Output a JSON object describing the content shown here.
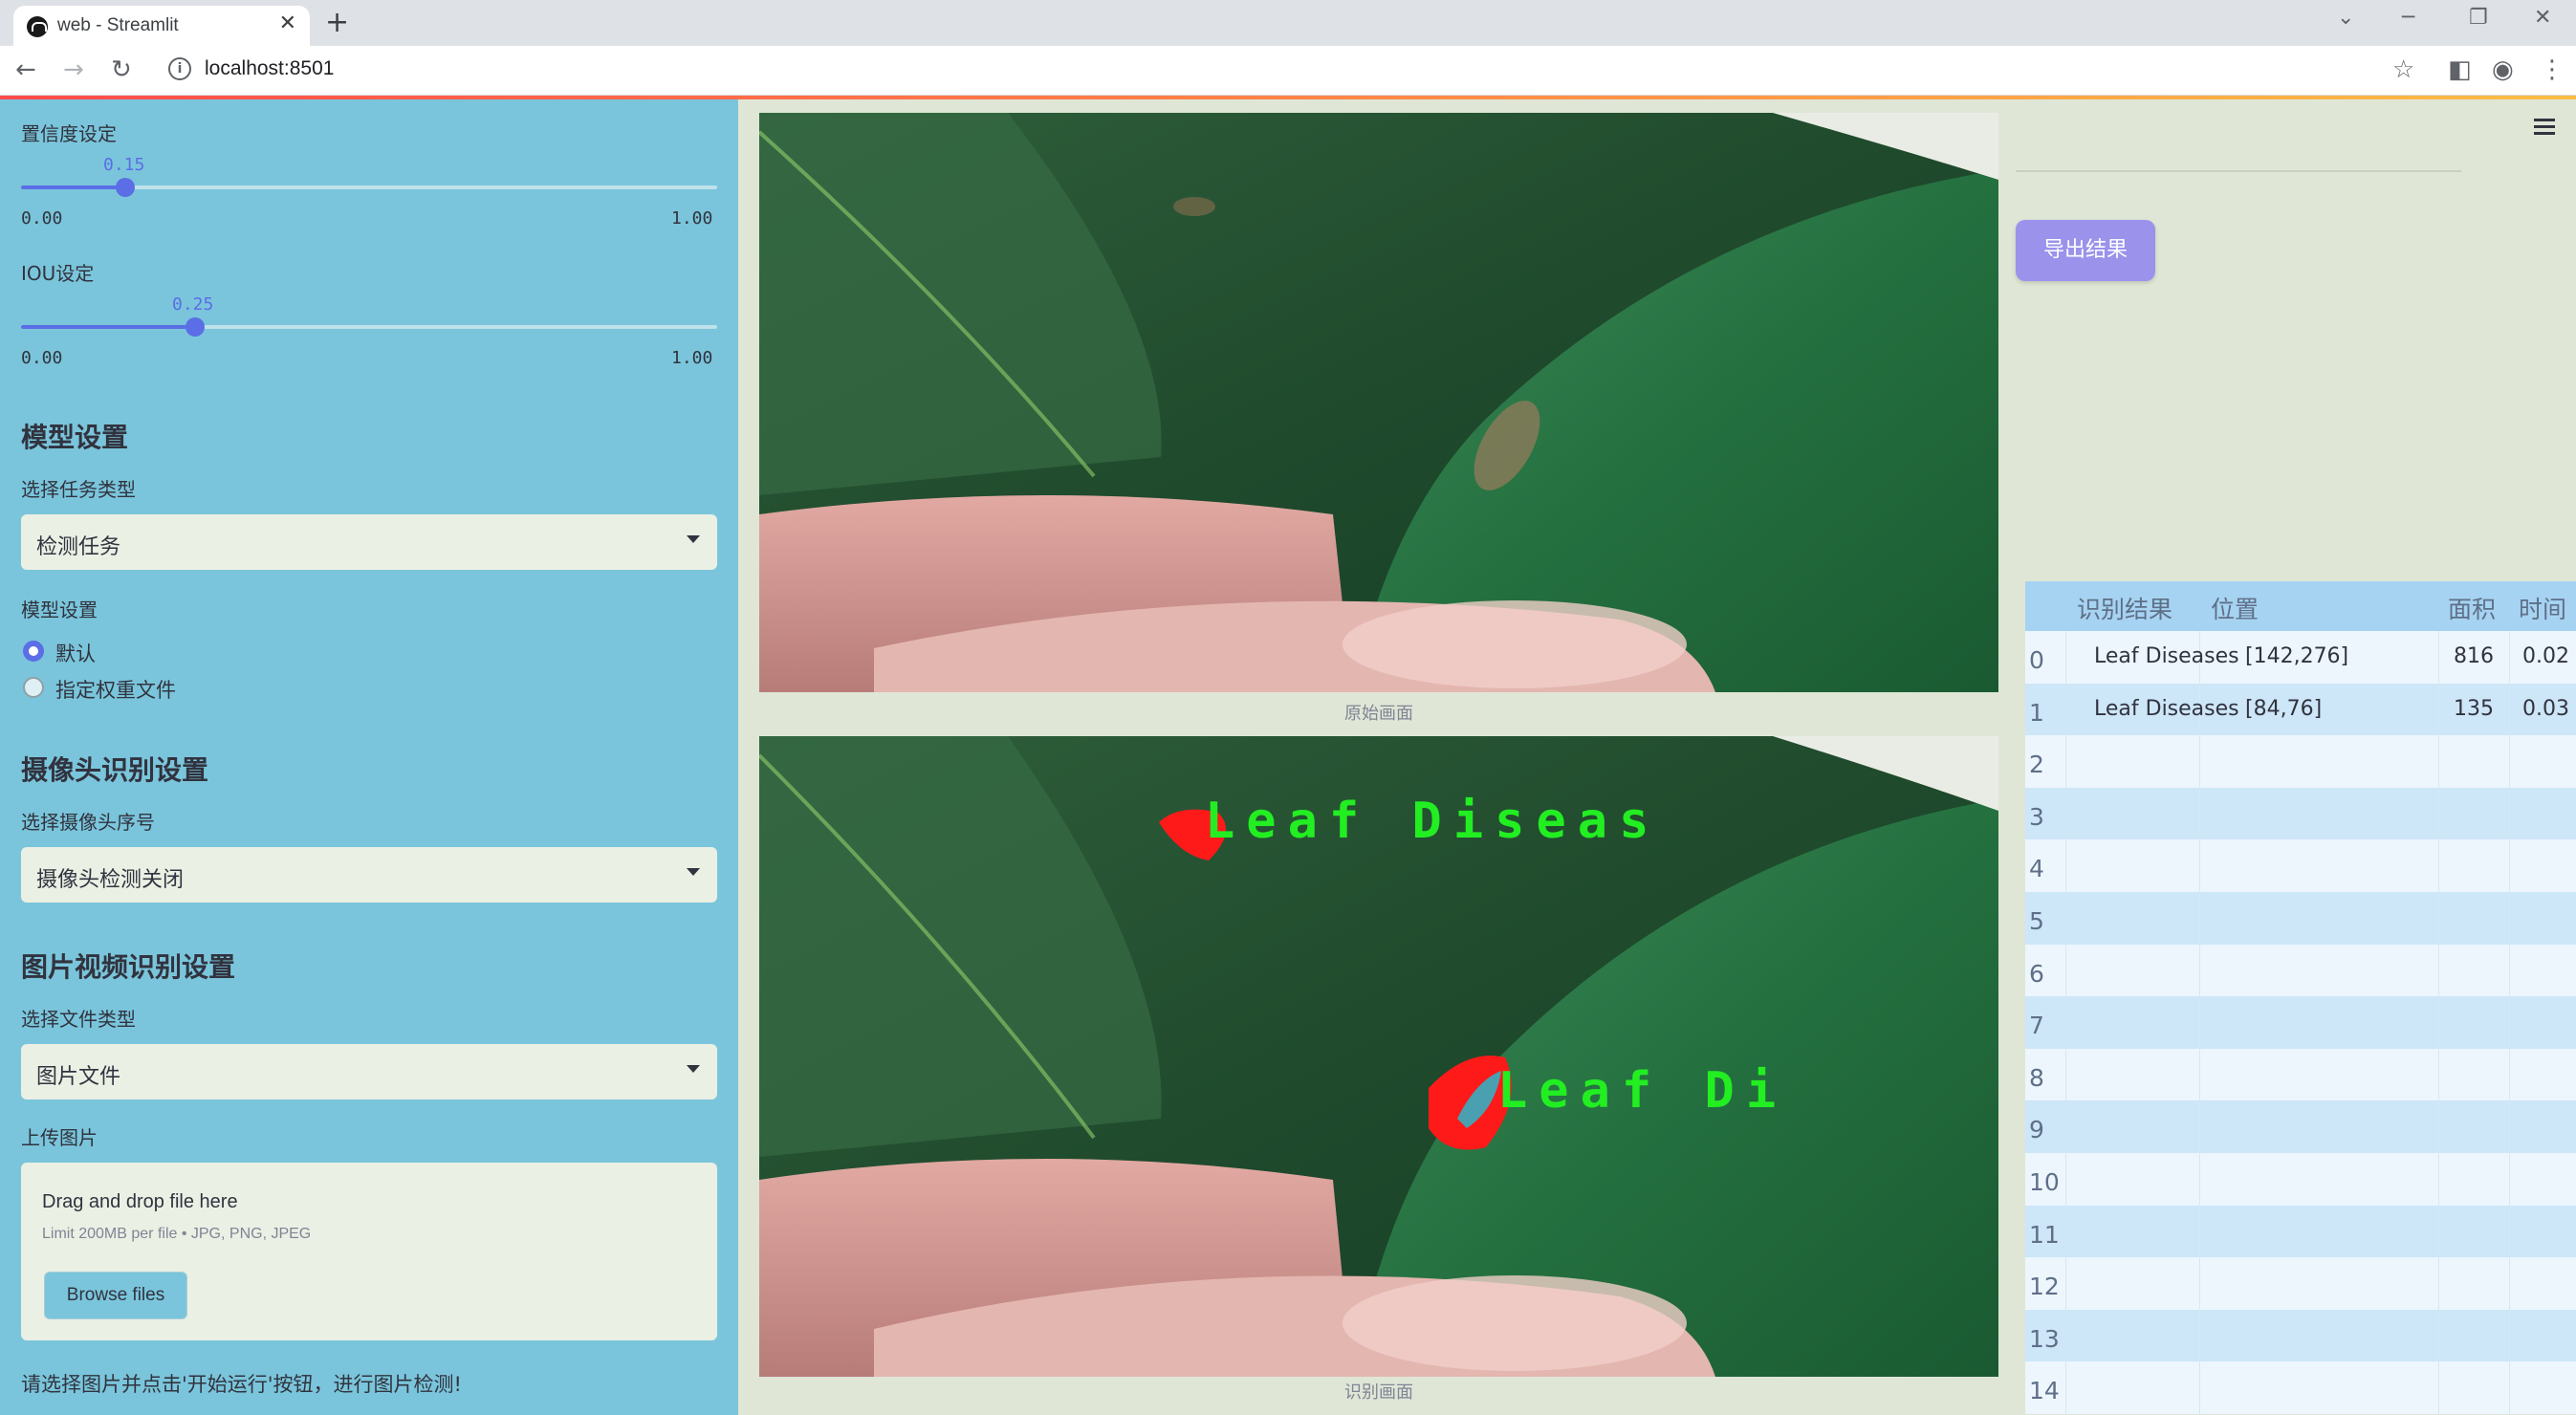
{
  "browser": {
    "tab_title": "web - Streamlit",
    "url": "localhost:8501"
  },
  "sidebar": {
    "confidence": {
      "label": "置信度设定",
      "value": "0.15",
      "value_num": 0.15,
      "min": "0.00",
      "max": "1.00"
    },
    "iou": {
      "label": "IOU设定",
      "value": "0.25",
      "value_num": 0.25,
      "min": "0.00",
      "max": "1.00"
    },
    "model_heading": "模型设置",
    "task_type_label": "选择任务类型",
    "task_type_value": "检测任务",
    "model_setting_label": "模型设置",
    "radio_options": [
      "默认",
      "指定权重文件"
    ],
    "radio_selected": "默认",
    "camera_heading": "摄像头识别设置",
    "camera_select_label": "选择摄像头序号",
    "camera_select_value": "摄像头检测关闭",
    "media_heading": "图片视频识别设置",
    "file_type_label": "选择文件类型",
    "file_type_value": "图片文件",
    "upload_label": "上传图片",
    "uploader": {
      "title": "Drag and drop file here",
      "limit": "Limit 200MB per file • JPG, PNG, JPEG",
      "browse": "Browse files"
    },
    "hint": "请选择图片并点击'开始运行'按钮，进行图片检测!"
  },
  "main": {
    "original_caption": "原始画面",
    "detected_caption": "识别画面",
    "detection_labels": [
      "Leaf Diseas",
      "Leaf Di"
    ]
  },
  "right": {
    "export_button": "导出结果",
    "table": {
      "columns": [
        "识别结果",
        "位置",
        "面积",
        "时间"
      ],
      "rows": [
        {
          "idx": "0",
          "result": "Leaf Diseases",
          "position": "[142,276]",
          "area": "816",
          "time": "0.02"
        },
        {
          "idx": "1",
          "result": "Leaf Diseases",
          "position": "[84,76]",
          "area": "135",
          "time": "0.03"
        },
        {
          "idx": "2"
        },
        {
          "idx": "3"
        },
        {
          "idx": "4"
        },
        {
          "idx": "5"
        },
        {
          "idx": "6"
        },
        {
          "idx": "7"
        },
        {
          "idx": "8"
        },
        {
          "idx": "9"
        },
        {
          "idx": "10"
        },
        {
          "idx": "11"
        },
        {
          "idx": "12"
        },
        {
          "idx": "13"
        },
        {
          "idx": "14"
        }
      ]
    }
  },
  "colors": {
    "sidebar_bg": "#7ac5db",
    "accent": "#5b6ee6",
    "export_button": "#9b92ec",
    "table_header": "#a6d3f2",
    "detection_box": "#ff1a1a",
    "detection_text": "#22ee22"
  }
}
